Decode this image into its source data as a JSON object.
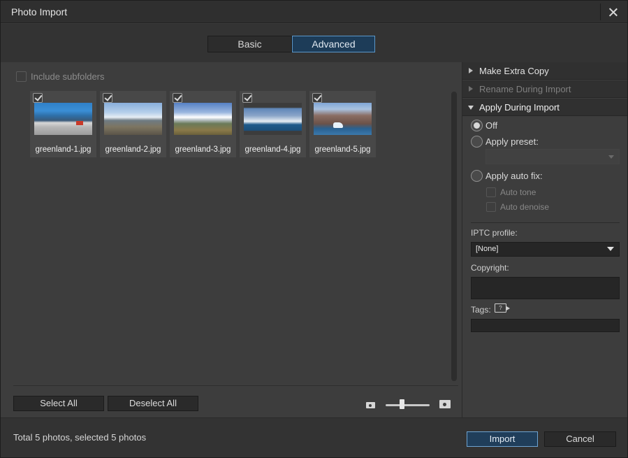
{
  "window": {
    "title": "Photo Import"
  },
  "tabs": [
    {
      "label": "Basic",
      "active": false
    },
    {
      "label": "Advanced",
      "active": true
    }
  ],
  "left": {
    "include_subfolders_label": "Include subfolders",
    "include_subfolders_checked": false,
    "photos": [
      {
        "name": "greenland-1.jpg",
        "checked": true
      },
      {
        "name": "greenland-2.jpg",
        "checked": true
      },
      {
        "name": "greenland-3.jpg",
        "checked": true
      },
      {
        "name": "greenland-4.jpg",
        "checked": true
      },
      {
        "name": "greenland-5.jpg",
        "checked": true
      }
    ],
    "select_all_label": "Select All",
    "deselect_all_label": "Deselect All",
    "zoom_level": 0.38
  },
  "right": {
    "sections": {
      "make_extra_copy": "Make Extra Copy",
      "rename_during_import": "Rename During Import",
      "apply_during_import": "Apply During Import"
    },
    "options": {
      "off": "Off",
      "apply_preset": "Apply preset:",
      "apply_auto_fix": "Apply auto fix:",
      "auto_tone": "Auto tone",
      "auto_denoise": "Auto denoise",
      "selected": "off"
    },
    "iptc_profile_label": "IPTC profile:",
    "iptc_profile_value": "[None]",
    "copyright_label": "Copyright:",
    "tags_label": "Tags:",
    "tags_icon_text": "?"
  },
  "footer": {
    "status": "Total 5 photos, selected 5 photos",
    "import_label": "Import",
    "cancel_label": "Cancel"
  },
  "colors": {
    "accent": "#5b97c9",
    "active_tab_bg": "#1d3c58",
    "panel_bg": "#3d3d3d"
  }
}
